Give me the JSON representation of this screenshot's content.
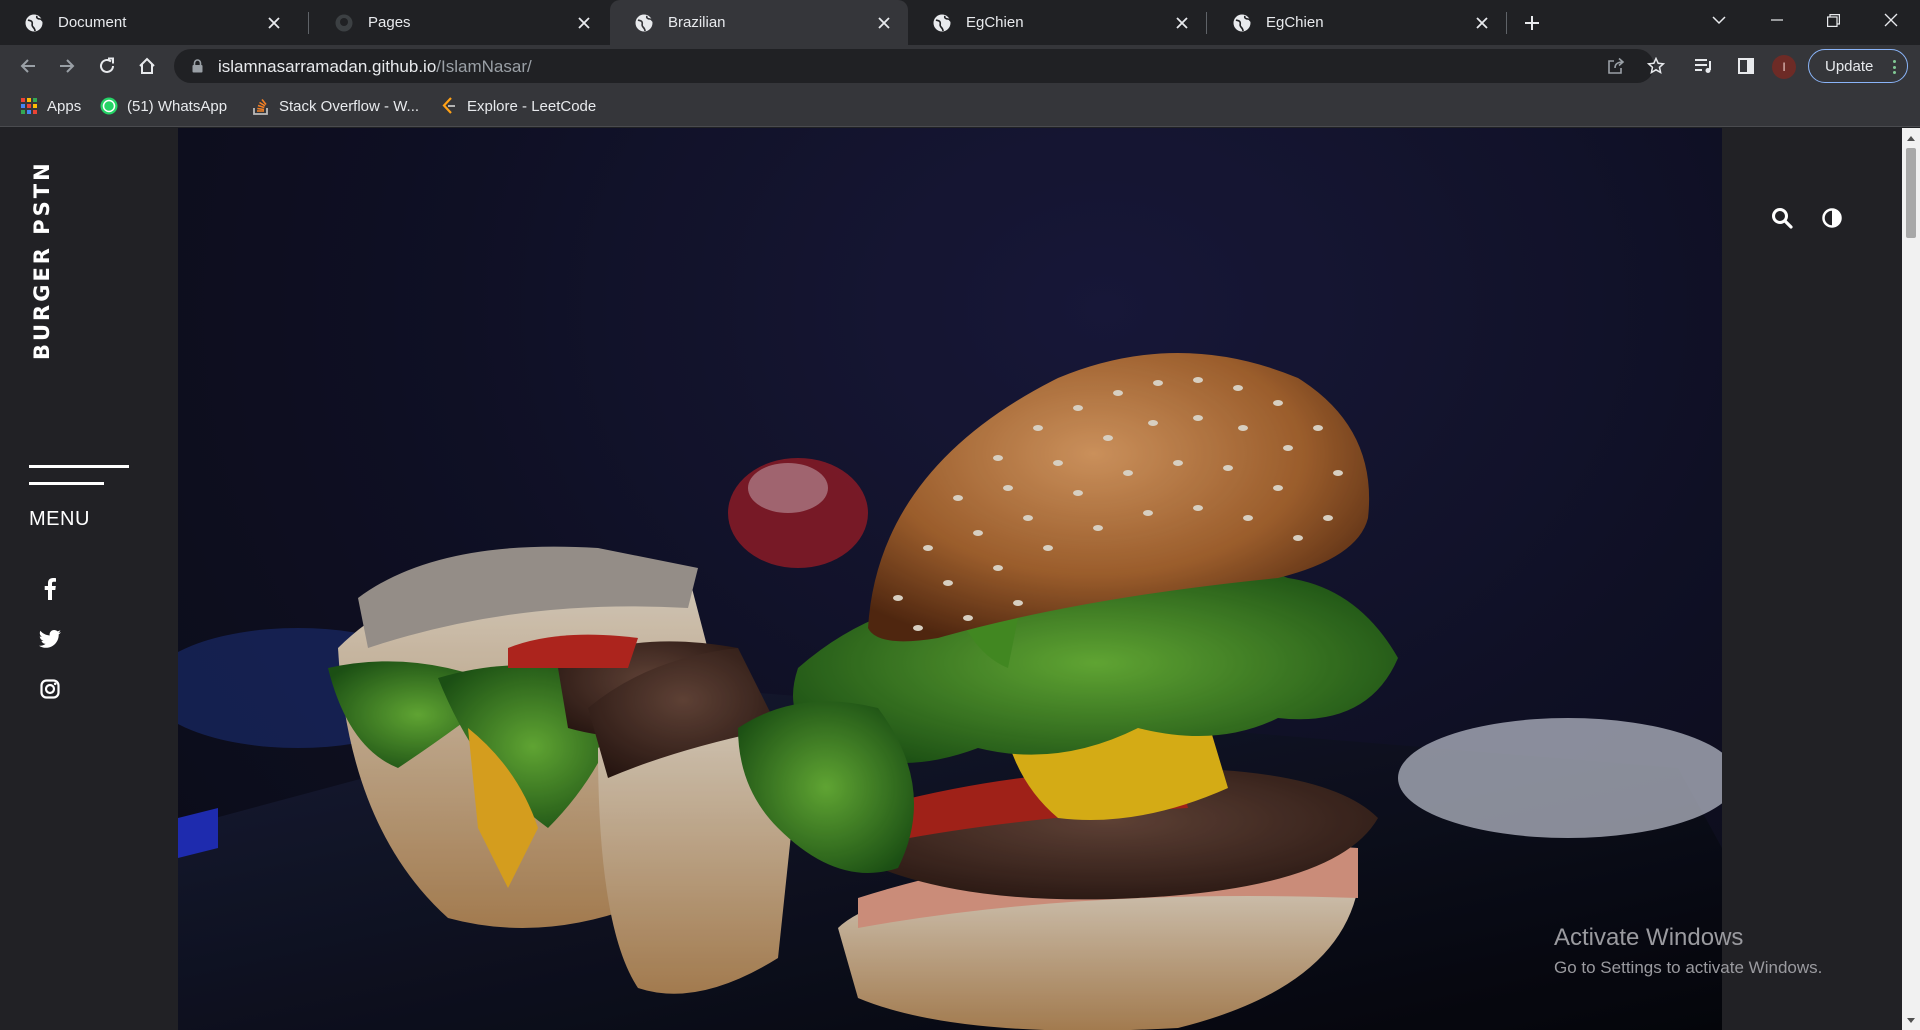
{
  "browser": {
    "tabs": [
      {
        "label": "Document",
        "icon": "globe-icon",
        "active": false
      },
      {
        "label": "Pages",
        "icon": "github-icon",
        "active": false
      },
      {
        "label": "Brazilian",
        "icon": "globe-icon",
        "active": true
      },
      {
        "label": "EgChien",
        "icon": "globe-icon",
        "active": false
      },
      {
        "label": "EgChien",
        "icon": "globe-icon",
        "active": false
      }
    ],
    "address": {
      "host": "islamnasarramadan.github.io",
      "path": "/IslamNasar/"
    },
    "profile_initial": "I",
    "update_label": "Update",
    "bookmarks": [
      {
        "label": "Apps",
        "icon": "apps-grid-icon"
      },
      {
        "label": "(51) WhatsApp",
        "icon": "whatsapp-icon"
      },
      {
        "label": "Stack Overflow - W...",
        "icon": "stackoverflow-icon"
      },
      {
        "label": "Explore - LeetCode",
        "icon": "leetcode-icon"
      }
    ]
  },
  "site": {
    "brand": "BURGER PSTN",
    "menu_label": "MENU",
    "social": [
      "facebook-icon",
      "twitter-icon",
      "instagram-icon"
    ],
    "header_icons": [
      "search-icon",
      "contrast-icon"
    ],
    "hero_image": "burger-photo"
  },
  "os": {
    "watermark_title": "Activate Windows",
    "watermark_text": "Go to Settings to activate Windows."
  },
  "colors": {
    "chrome_dark": "#202124",
    "chrome_toolbar": "#35363a",
    "page_bg": "#212125",
    "update_border": "#8ab4f8"
  }
}
